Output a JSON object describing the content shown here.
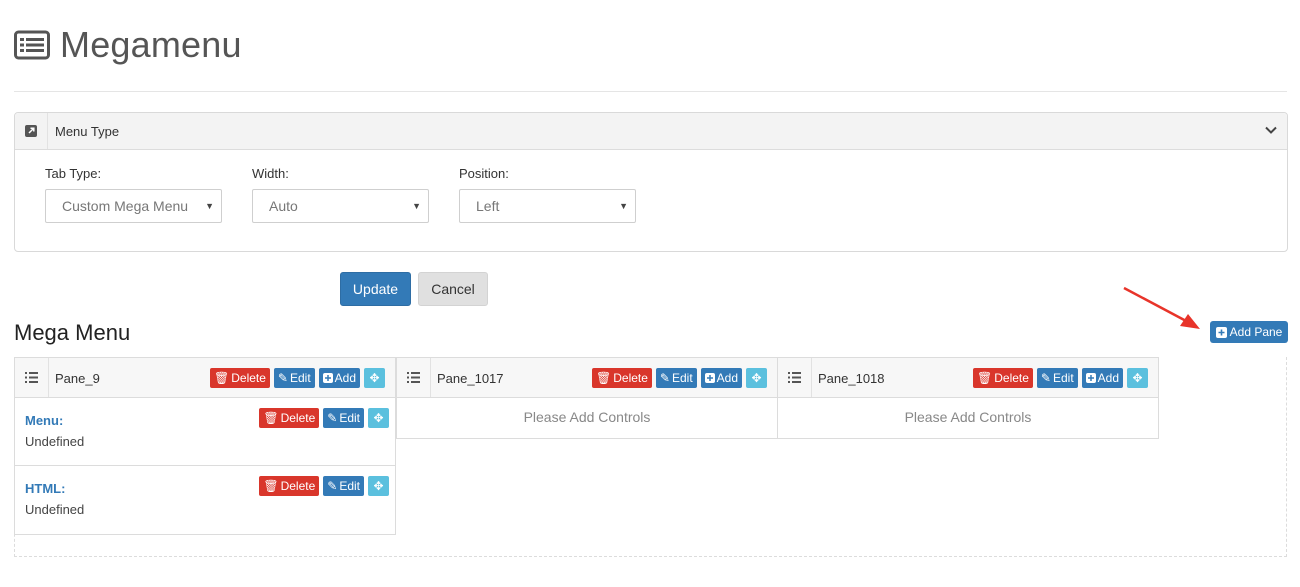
{
  "page": {
    "title": "Megamenu",
    "icon": "list-alt-icon"
  },
  "menu_type_panel": {
    "title": "Menu Type",
    "fields": [
      {
        "label": "Tab Type:",
        "value": "Custom Mega Menu"
      },
      {
        "label": "Width:",
        "value": "Auto"
      },
      {
        "label": "Position:",
        "value": "Left"
      }
    ]
  },
  "actions": {
    "update_label": "Update",
    "cancel_label": "Cancel"
  },
  "mega_menu": {
    "title": "Mega Menu",
    "add_pane_label": "Add Pane",
    "panes": [
      {
        "name": "Pane_9",
        "buttons": {
          "delete": "Delete",
          "edit": "Edit",
          "add": "Add"
        },
        "controls": [
          {
            "title": "Menu:",
            "value": "Undefined",
            "buttons": {
              "delete": "Delete",
              "edit": "Edit"
            }
          },
          {
            "title": "HTML:",
            "value": "Undefined",
            "buttons": {
              "delete": "Delete",
              "edit": "Edit"
            }
          }
        ]
      },
      {
        "name": "Pane_1017",
        "buttons": {
          "delete": "Delete",
          "edit": "Edit",
          "add": "Add"
        },
        "empty_text": "Please Add Controls"
      },
      {
        "name": "Pane_1018",
        "buttons": {
          "delete": "Delete",
          "edit": "Edit",
          "add": "Add"
        },
        "empty_text": "Please Add Controls"
      }
    ]
  },
  "colors": {
    "primary": "#337ab7",
    "danger": "#d9362b",
    "info": "#5bc0de",
    "annotation_arrow": "#e8342a"
  }
}
